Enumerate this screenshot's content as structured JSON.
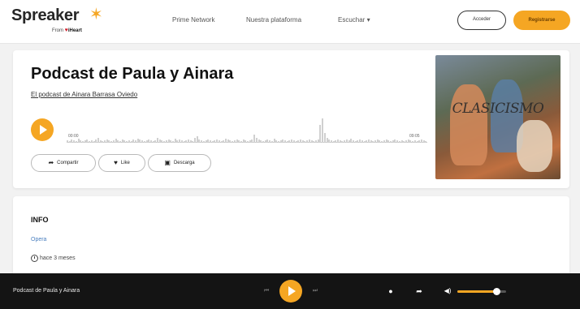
{
  "header": {
    "logo_text": "Spreaker",
    "logo_sub_from": "From",
    "logo_sub_brand": "iHeart",
    "nav": [
      "Prime Network",
      "Nuestra plataforma",
      "Escuchar"
    ],
    "login_label": "Acceder",
    "register_label": "Registrarse"
  },
  "episode": {
    "title": "Podcast de Paula y Ainara",
    "show_link": "El podcast de Ainara Barrasa Oviedo",
    "time_start": "00:00",
    "time_end": "09:05",
    "actions": [
      {
        "label": "Compartir",
        "icon": "share-icon"
      },
      {
        "label": "Like",
        "icon": "heart-icon"
      },
      {
        "label": "Descarga",
        "icon": "download-icon"
      }
    ],
    "cover_text": "CLASICISMO",
    "waveform": [
      3,
      2,
      4,
      3,
      2,
      5,
      3,
      2,
      3,
      4,
      2,
      3,
      2,
      4,
      6,
      3,
      2,
      3,
      4,
      3,
      2,
      3,
      5,
      3,
      2,
      4,
      3,
      2,
      3,
      2,
      4,
      3,
      5,
      4,
      3,
      2,
      3,
      4,
      3,
      2,
      3,
      6,
      4,
      3,
      2,
      3,
      4,
      3,
      2,
      5,
      3,
      4,
      3,
      2,
      3,
      4,
      3,
      2,
      6,
      8,
      4,
      3,
      2,
      3,
      4,
      3,
      2,
      3,
      4,
      3,
      2,
      3,
      5,
      4,
      3,
      2,
      3,
      4,
      3,
      2,
      4,
      3,
      2,
      3,
      4,
      10,
      6,
      4,
      3,
      2,
      3,
      4,
      3,
      2,
      5,
      3,
      2,
      3,
      4,
      3,
      2,
      3,
      4,
      3,
      2,
      3,
      4,
      3,
      2,
      3,
      4,
      3,
      2,
      3,
      4,
      22,
      30,
      12,
      6,
      4,
      3,
      2,
      3,
      4,
      3,
      2,
      3,
      4,
      3,
      5,
      3,
      2,
      3,
      4,
      3,
      2,
      3,
      4,
      3,
      2,
      3,
      4,
      3,
      2,
      3,
      4,
      3,
      2,
      3,
      4,
      3,
      2,
      3,
      2,
      3,
      4,
      3,
      2,
      3,
      2,
      3,
      4,
      3,
      2
    ]
  },
  "info": {
    "title": "INFO",
    "category": "Opera",
    "time_ago": "hace 3 meses"
  },
  "player": {
    "title": "Podcast de Paula y Ainara",
    "volume": 0.8
  },
  "colors": {
    "accent": "#f5a623",
    "player_bg": "#141414",
    "link_blue": "#4a7fbf"
  }
}
